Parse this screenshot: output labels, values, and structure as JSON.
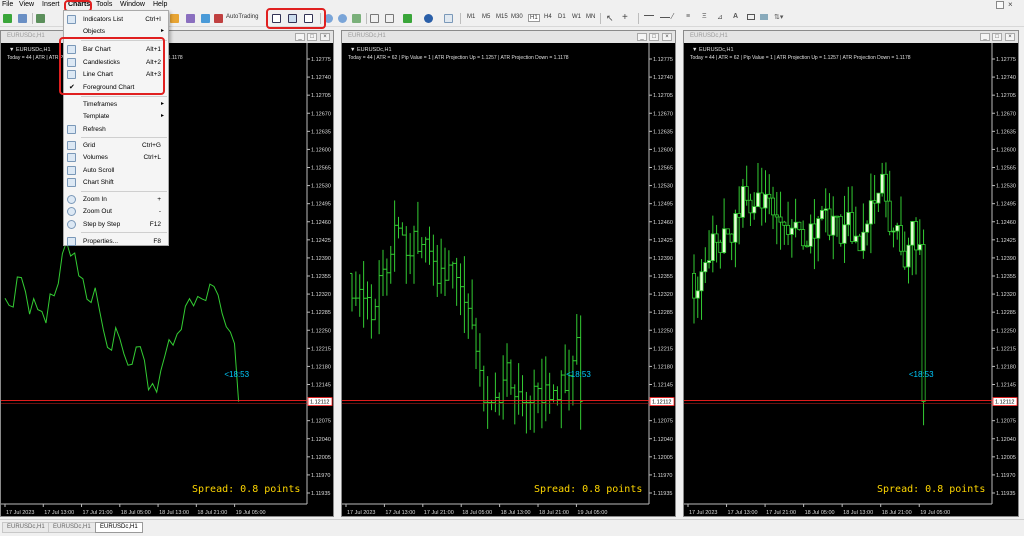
{
  "menu": [
    "File",
    "View",
    "Insert",
    "Charts",
    "Tools",
    "Window",
    "Help"
  ],
  "toolbar": {
    "autotrading_label": "AutoTrading",
    "timeframes": [
      "M1",
      "M5",
      "M15",
      "M30",
      "H1",
      "H4",
      "D1",
      "W1",
      "MN"
    ]
  },
  "charts_menu": {
    "items": [
      {
        "label": "Indicators List",
        "shortcut": "Ctrl+I"
      },
      {
        "label": "Objects",
        "shortcut": ""
      },
      {
        "label": "Bar Chart",
        "shortcut": "Alt+1"
      },
      {
        "label": "Candlesticks",
        "shortcut": "Alt+2"
      },
      {
        "label": "Line Chart",
        "shortcut": "Alt+3"
      },
      {
        "label": "Foreground Chart",
        "shortcut": ""
      },
      {
        "label": "Timeframes",
        "shortcut": ""
      },
      {
        "label": "Template",
        "shortcut": ""
      },
      {
        "label": "Refresh",
        "shortcut": ""
      },
      {
        "label": "Grid",
        "shortcut": "Ctrl+G"
      },
      {
        "label": "Volumes",
        "shortcut": "Ctrl+L"
      },
      {
        "label": "Auto Scroll",
        "shortcut": ""
      },
      {
        "label": "Chart Shift",
        "shortcut": ""
      },
      {
        "label": "Zoom In",
        "shortcut": "+"
      },
      {
        "label": "Zoom Out",
        "shortcut": "-"
      },
      {
        "label": "Step by Step",
        "shortcut": "F12"
      },
      {
        "label": "Properties...",
        "shortcut": "F8"
      }
    ]
  },
  "windows": [
    {
      "title": "EURUSDc,H1",
      "symbol_label": "EURUSDc,H1",
      "info": "Today = 44  |  ATR   |  ATR Projection Up = 1.1257  |  ATR Projection Down = 1.1178",
      "spread": "Spread: 0.8 points",
      "timer": "<18:53",
      "price_tag": "1.12112",
      "chart_type": "line"
    },
    {
      "title": "EURUSDc,H1",
      "symbol_label": "EURUSDc,H1",
      "info": "Today = 44  |  ATR = 62  |  Pip Value = 1  |  ATR Projection Up = 1.1257  |  ATR Projection Down = 1.1178",
      "spread": "Spread: 0.8 points",
      "timer": "<18:53",
      "price_tag": "1.12112",
      "chart_type": "bar"
    },
    {
      "title": "EURUSDc,H1",
      "symbol_label": "EURUSDc,H1",
      "info": "Today = 44  |  ATR = 62  |  Pip Value = 1  |  ATR Projection Up = 1.1257  |  ATR Projection Down = 1.1178",
      "spread": "Spread: 0.8 points",
      "timer": "<18:53",
      "price_tag": "1.12112",
      "chart_type": "candlesticks"
    }
  ],
  "price_axis": [
    "1.12775",
    "1.12740",
    "1.12705",
    "1.12670",
    "1.12635",
    "1.12600",
    "1.12565",
    "1.12530",
    "1.12495",
    "1.12460",
    "1.12425",
    "1.12390",
    "1.12355",
    "1.12320",
    "1.12285",
    "1.12250",
    "1.12215",
    "1.12180",
    "1.12145",
    "1.12112",
    "1.12075",
    "1.12040",
    "1.12005",
    "1.11970",
    "1.11935"
  ],
  "time_axis_left": [
    "17 Jul 2023",
    "17 Jul 13:00",
    "17 Jul 21:00",
    "18 Jul 05:00",
    "18 Jul 13:00",
    "18 Jul 21:00",
    "19 Jul 05:00"
  ],
  "time_axis": [
    "17 Jul 2023",
    "17 Jul 13:00",
    "17 Jul 21:00",
    "18 Jul 05:00",
    "18 Jul 13:00",
    "18 Jul 21:00",
    "19 Jul 05:00"
  ],
  "tabs": [
    "EURUSDc,H1",
    "EURUSDc,H1",
    "EURUSDc,H1"
  ],
  "colors": {
    "bull": "#33cc33",
    "bear": "#33cc33",
    "candle_up_fill": "#e8ffd8",
    "spread_text": "#ffd700",
    "timer_text": "#00ccff",
    "price_line": "#ff2020",
    "highlight": "#e02020"
  }
}
